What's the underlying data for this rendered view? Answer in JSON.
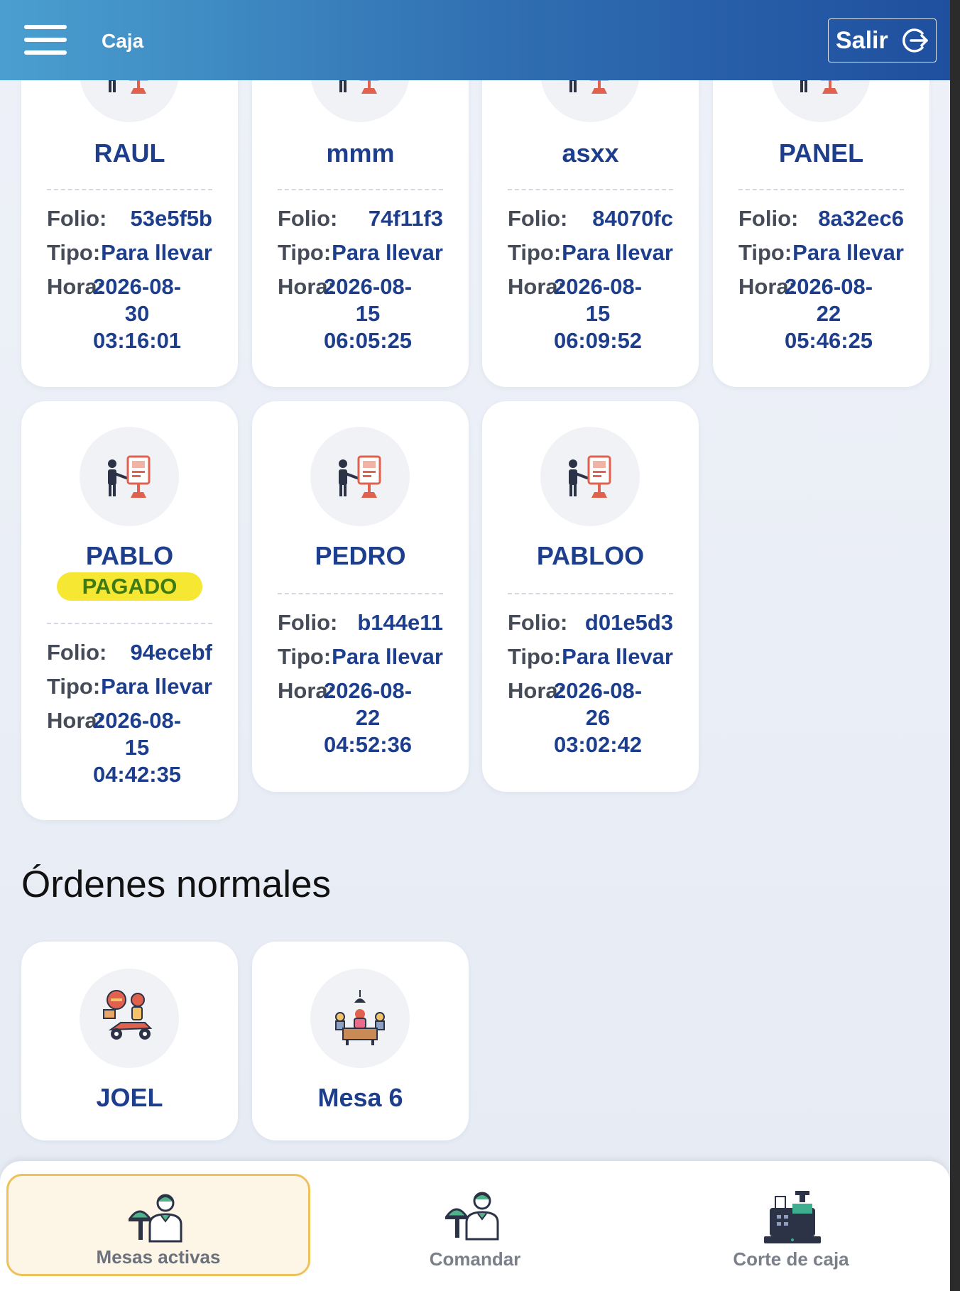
{
  "header": {
    "title": "Caja",
    "logout_label": "Salir"
  },
  "labels": {
    "folio": "Folio:",
    "tipo": "Tipo:",
    "hora": "Hora:"
  },
  "orders_top": [
    {
      "name": "RAUL",
      "folio": "53e5f5b",
      "tipo": "Para llevar",
      "hora1": "2026-08-",
      "hora2": "30",
      "hora3": "03:16:01"
    },
    {
      "name": "mmm",
      "folio": "74f11f3",
      "tipo": "Para llevar",
      "hora1": "2026-08-",
      "hora2": "15",
      "hora3": "06:05:25"
    },
    {
      "name": "asxx",
      "folio": "84070fc",
      "tipo": "Para llevar",
      "hora1": "2026-08-",
      "hora2": "15",
      "hora3": "06:09:52"
    },
    {
      "name": "PANEL",
      "folio": "8a32ec6",
      "tipo": "Para llevar",
      "hora1": "2026-08-",
      "hora2": "22",
      "hora3": "05:46:25"
    }
  ],
  "orders_mid": [
    {
      "name": "PABLO",
      "badge": "PAGADO",
      "folio": "94ecebf",
      "tipo": "Para llevar",
      "hora1": "2026-08-",
      "hora2": "15",
      "hora3": "04:42:35"
    },
    {
      "name": "PEDRO",
      "folio": "b144e11",
      "tipo": "Para llevar",
      "hora1": "2026-08-",
      "hora2": "22",
      "hora3": "04:52:36"
    },
    {
      "name": "PABLOO",
      "folio": "d01e5d3",
      "tipo": "Para llevar",
      "hora1": "2026-08-",
      "hora2": "26",
      "hora3": "03:02:42"
    }
  ],
  "normal_section": {
    "title": "Órdenes normales"
  },
  "normal_orders": [
    {
      "name": "JOEL",
      "icon": "delivery-scooter-icon"
    },
    {
      "name": "Mesa 6",
      "icon": "dining-table-icon"
    }
  ],
  "bottom_nav": {
    "items": [
      {
        "label": "Mesas activas",
        "icon": "waiter-icon",
        "active": true
      },
      {
        "label": "Comandar",
        "icon": "waiter-icon",
        "active": false
      },
      {
        "label": "Corte de caja",
        "icon": "cash-register-icon",
        "active": false
      }
    ]
  },
  "colors": {
    "accent": "#1d3e8c",
    "badge_bg": "#f6e832",
    "badge_text": "#3e7b15",
    "active_nav_border": "#efc15b"
  }
}
